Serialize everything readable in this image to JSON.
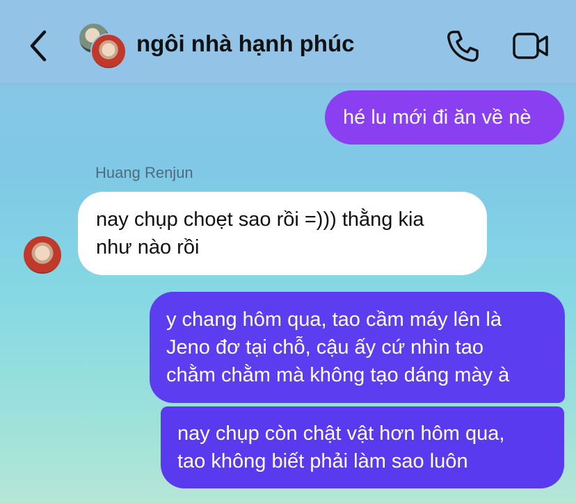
{
  "header": {
    "title": "ngôi nhà hạnh phúc",
    "back_icon": "chevron-left-icon",
    "call_icon": "phone-icon",
    "video_icon": "video-camera-icon"
  },
  "messages": [
    {
      "direction": "outgoing",
      "lines": [
        "hé lu mới đi ăn về nè"
      ],
      "color": "#8a40f0"
    },
    {
      "direction": "incoming",
      "sender": "Huang Renjun",
      "lines": [
        "nay chụp choẹt sao rồi =))) thằng kia",
        "như nào rồi"
      ],
      "color": "#ffffff"
    },
    {
      "direction": "outgoing",
      "lines": [
        "y chang hôm qua, tao cầm máy lên là",
        "Jeno đơ tại chỗ, cậu ấy cứ nhìn tao",
        "chằm chằm mà không tạo dáng mày à"
      ],
      "color": "#5d3df0"
    },
    {
      "direction": "outgoing",
      "lines": [
        "nay chụp còn chật vật hơn hôm qua,",
        "tao không biết phải làm sao luôn"
      ],
      "color": "#5a3aee"
    }
  ]
}
